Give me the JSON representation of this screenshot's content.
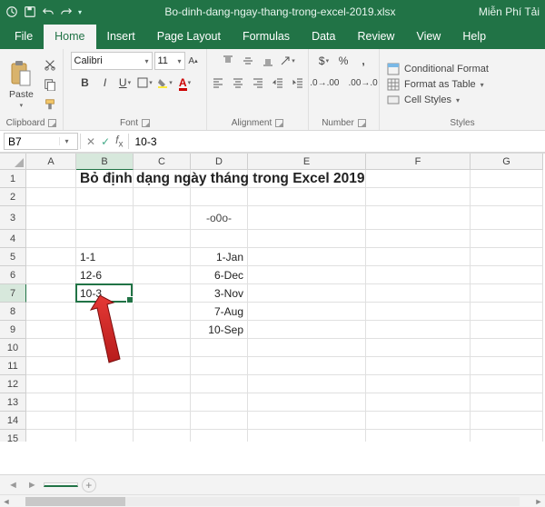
{
  "titlebar": {
    "filename": "Bo-dinh-dang-ngay-thang-trong-excel-2019.xlsx",
    "right_text": "Miễn Phí Tải"
  },
  "tabs": {
    "file": "File",
    "home": "Home",
    "insert": "Insert",
    "page_layout": "Page Layout",
    "formulas": "Formulas",
    "data": "Data",
    "review": "Review",
    "view": "View",
    "help": "Help"
  },
  "ribbon": {
    "clipboard": {
      "label": "Clipboard",
      "paste": "Paste"
    },
    "font": {
      "label": "Font",
      "name": "Calibri",
      "size": "11"
    },
    "alignment": {
      "label": "Alignment"
    },
    "number": {
      "label": "Number"
    },
    "styles": {
      "label": "Styles",
      "conditional": "Conditional Format",
      "table": "Format as Table",
      "cell": "Cell Styles"
    }
  },
  "formula_bar": {
    "name_box": "B7",
    "formula": "10-3"
  },
  "columns": [
    "A",
    "B",
    "C",
    "D",
    "E",
    "F",
    "G"
  ],
  "selected_col": "B",
  "selected_row": "7",
  "rows": [
    "1",
    "2",
    "3",
    "4",
    "5",
    "6",
    "7",
    "8",
    "9",
    "10",
    "11",
    "12",
    "13",
    "14",
    "15"
  ],
  "cells": {
    "title": "Bỏ định dạng ngày tháng trong Excel 2019",
    "separator": "-o0o-",
    "B5": "1-1",
    "D5": "1-Jan",
    "B6": "12-6",
    "D6": "6-Dec",
    "B7": "10-3",
    "D7": "3-Nov",
    "D8": "7-Aug",
    "D9": "10-Sep"
  },
  "sheet": {
    "active": " "
  }
}
